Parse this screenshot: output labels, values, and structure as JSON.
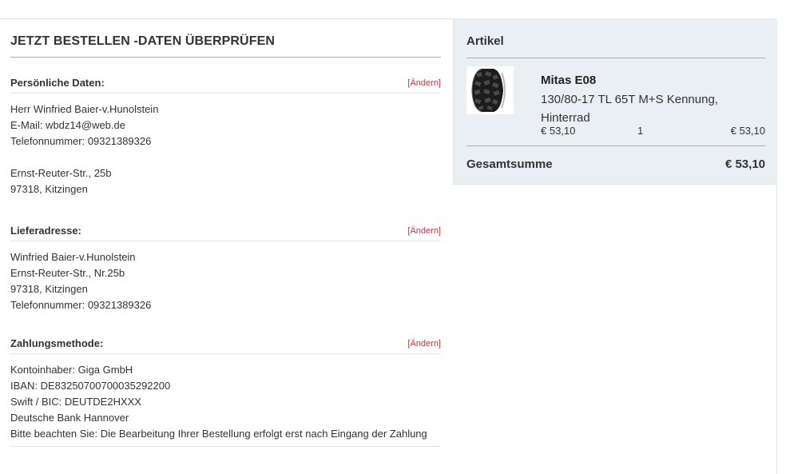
{
  "order": {
    "title": "JETZT BESTELLEN -DATEN ÜBERPRÜFEN",
    "edit_label": "[Ändern]",
    "personal": {
      "heading": "Persönliche Daten:",
      "name": "Herr Winfried Baier-v.Hunolstein",
      "email": "E-Mail: wbdz14@web.de",
      "phone": "Telefonnummer: 09321389326",
      "street": "Ernst-Reuter-Str., 25b",
      "city": "97318, Kitzingen"
    },
    "delivery": {
      "heading": "Lieferadresse:",
      "name": "Winfried Baier-v.Hunolstein",
      "street": "Ernst-Reuter-Str., Nr.25b",
      "city": "97318, Kitzingen",
      "phone": "Telefonnummer: 09321389326"
    },
    "payment": {
      "heading": "Zahlungsmethode:",
      "owner": "Kontoinhaber: Giga GmbH",
      "iban": "IBAN: DE83250700700035292200",
      "bic": "Swift / BIC: DEUTDE2HXXX",
      "bank": "Deutsche Bank Hannover",
      "note": "Bitte beachten Sie: Die Bearbeitung Ihrer Bestellung erfolgt erst nach Eingang der Zahlung"
    }
  },
  "cart": {
    "title": "Artikel",
    "item": {
      "name": "Mitas E08",
      "description": "130/80-17 TL 65T M+S Kennung, Hinterrad",
      "unit_price": "€ 53,10",
      "quantity": "1",
      "total": "€ 53,10",
      "image_icon": "tire-icon"
    },
    "total_label": "Gesamtsumme",
    "total_value": "€ 53,10"
  }
}
